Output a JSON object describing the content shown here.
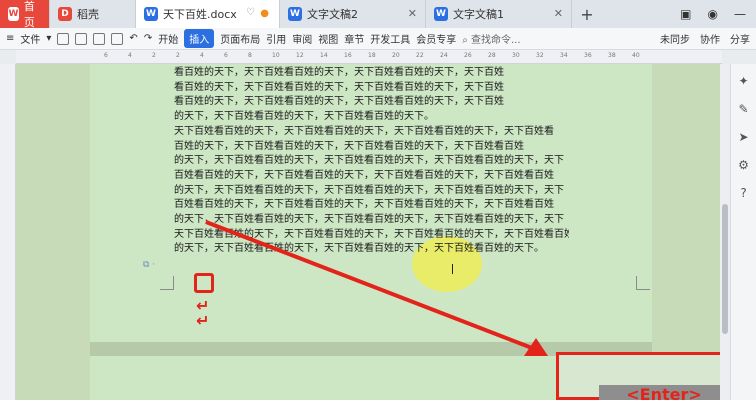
{
  "tabs": [
    {
      "label": "首页",
      "icon": "wps-home-icon"
    },
    {
      "label": "稻壳",
      "icon": "docer-icon"
    },
    {
      "label": "天下百姓.docx",
      "icon": "writer-doc-icon",
      "active": true
    },
    {
      "label": "文字文稿2",
      "icon": "writer-doc-icon"
    },
    {
      "label": "文字文稿1",
      "icon": "writer-doc-icon"
    }
  ],
  "ribbon": {
    "file_menu": "文件",
    "menus": [
      "开始",
      "插入",
      "页面布局",
      "引用",
      "审阅",
      "视图",
      "章节",
      "开发工具",
      "会员专享"
    ],
    "active_menu": "插入",
    "search_placeholder": "查找命令...",
    "sync": "未同步",
    "collab": "协作",
    "share": "分享"
  },
  "ruler": {
    "ticks": [
      "6",
      "4",
      "2",
      "2",
      "4",
      "6",
      "8",
      "10",
      "12",
      "14",
      "16",
      "18",
      "20",
      "22",
      "24",
      "26",
      "28",
      "30",
      "32",
      "34",
      "36",
      "38",
      "40"
    ]
  },
  "document": {
    "lines": [
      "看百姓的天下，天下百姓看百姓的天下，天下百姓看百姓的天下，天下百姓",
      "看百姓的天下，天下百姓看百姓的天下，天下百姓看百姓的天下，天下百姓",
      "看百姓的天下，天下百姓看百姓的天下，天下百姓看百姓的天下，天下百姓",
      "的天下，天下百姓看百姓的天下，天下百姓看百姓的天下。",
      "    天下百姓看百姓的天下，天下百姓看百姓的天下，天下百姓看百姓的天下，天下百姓看",
      "百姓的天下，天下百姓看百姓的天下，天下百姓看百姓的天下，天下百姓看百姓",
      "的天下，天下百姓看百姓的天下，天下百姓看百姓的天下，天下百姓看百姓的天下，天下",
      "百姓看百姓的天下，天下百姓看百姓的天下，天下百姓看百姓的天下，天下百姓看百姓",
      "的天下，天下百姓看百姓的天下，天下百姓看百姓的天下，天下百姓看百姓的天下，天下",
      "百姓看百姓的天下，天下百姓看百姓的天下，天下百姓看百姓的天下，天下百姓看百姓",
      "的天下，天下百姓看百姓的天下，天下百姓看百姓的天下，天下百姓看百姓的天下，天下",
      "天下百姓看百姓的天下，天下百姓看百姓的天下，天下百姓看百姓的天下，天下百姓看百姓",
      "的天下，天下百姓看百姓的天下，天下百姓看百姓的天下，天下百姓看百姓的天下。"
    ]
  },
  "annotations": {
    "red_mark": "↵",
    "enter_label": "<Enter>"
  },
  "colors": {
    "accent": "#2b6fe0",
    "annotation_red": "#e3241b",
    "highlight_yellow": "#fff01e",
    "page_green": "#cde6c4"
  }
}
